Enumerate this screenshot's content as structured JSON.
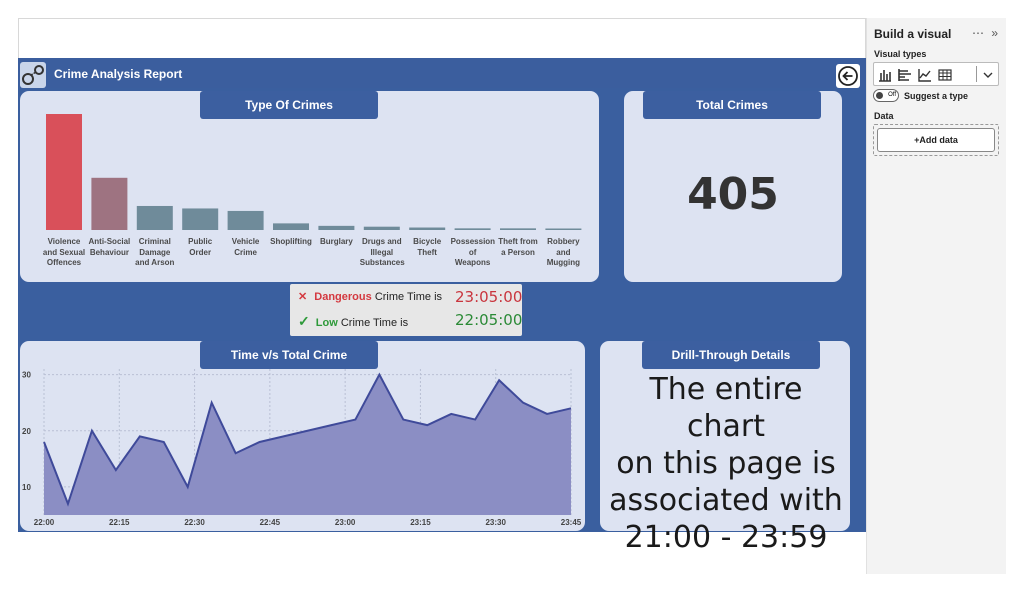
{
  "report": {
    "title": "Crime Analysis Report"
  },
  "type_of_crimes": {
    "header": "Type Of Crimes"
  },
  "total_crimes": {
    "header": "Total Crimes",
    "value": "405"
  },
  "time_card": {
    "header": "Time v/s Total Crime"
  },
  "drill": {
    "header": "Drill-Through Details",
    "lines": [
      "The entire chart",
      "on this page is",
      "associated with",
      "21:00 - 23:59"
    ]
  },
  "note": {
    "dangerous_word": "Dangerous",
    "dangerous_rest": "Crime Time is",
    "dangerous_time": "23:05:00",
    "low_word": "Low",
    "low_rest": "Crime Time is",
    "low_time": "22:05:00"
  },
  "panel": {
    "title": "Build a visual",
    "visual_types": "Visual types",
    "toggle_state": "Off",
    "suggest": "Suggest a type",
    "data_label": "Data",
    "add_data": "+Add data"
  },
  "colors": {
    "bar_top": "#d9505a",
    "bar_second": "#9e7381",
    "bar_rest": "#6f8b9a",
    "area_fill": "#8b8ec4",
    "area_line": "#3f4a9a",
    "dangerous": "#d4393f",
    "low": "#2e9a3a"
  },
  "chart_data": [
    {
      "type": "bar",
      "title": "Type Of Crimes",
      "categories": [
        "Violence and Sexual Offences",
        "Anti-Social Behaviour",
        "Criminal Damage and Arson",
        "Public Order",
        "Vehicle Crime",
        "Shoplifting",
        "Burglary",
        "Drugs and Illegal Substances",
        "Bicycle Theft",
        "Possession of Weapons",
        "Theft from a Person",
        "Robbery and Mugging"
      ],
      "category_lines": [
        [
          "Violence",
          "and Sexual",
          "Offences"
        ],
        [
          "Anti-Social",
          "Behaviour"
        ],
        [
          "Criminal",
          "Damage",
          "and Arson"
        ],
        [
          "Public",
          "Order"
        ],
        [
          "Vehicle",
          "Crime"
        ],
        [
          "Shoplifting"
        ],
        [
          "Burglary"
        ],
        [
          "Drugs and",
          "Illegal",
          "Substances"
        ],
        [
          "Bicycle",
          "Theft"
        ],
        [
          "Possession",
          "of",
          "Weapons"
        ],
        [
          "Theft from",
          "a Person"
        ],
        [
          "Robbery",
          "and",
          "Mugging"
        ]
      ],
      "values": [
        140,
        63,
        29,
        26,
        23,
        8,
        5,
        4,
        3,
        2,
        2,
        1
      ]
    },
    {
      "type": "area",
      "title": "Time v/s Total Crime",
      "x_ticks": [
        "22:00",
        "22:15",
        "22:30",
        "22:45",
        "23:00",
        "23:15",
        "23:30",
        "23:45"
      ],
      "x_minutes": [
        0,
        3,
        7,
        10,
        14,
        17,
        20,
        24,
        27,
        30,
        33,
        36,
        40,
        44,
        47,
        50,
        54,
        57,
        60,
        64,
        67,
        71,
        74,
        77,
        80,
        84,
        87,
        90,
        95
      ],
      "y": [
        18,
        7,
        20,
        13,
        19,
        18,
        10,
        25,
        16,
        18,
        19,
        20,
        21,
        22,
        30,
        22,
        21,
        23,
        22,
        29,
        25,
        23,
        24
      ],
      "y_ticks": [
        10,
        20,
        30
      ],
      "ylim": [
        5,
        31
      ],
      "grid": true
    }
  ]
}
